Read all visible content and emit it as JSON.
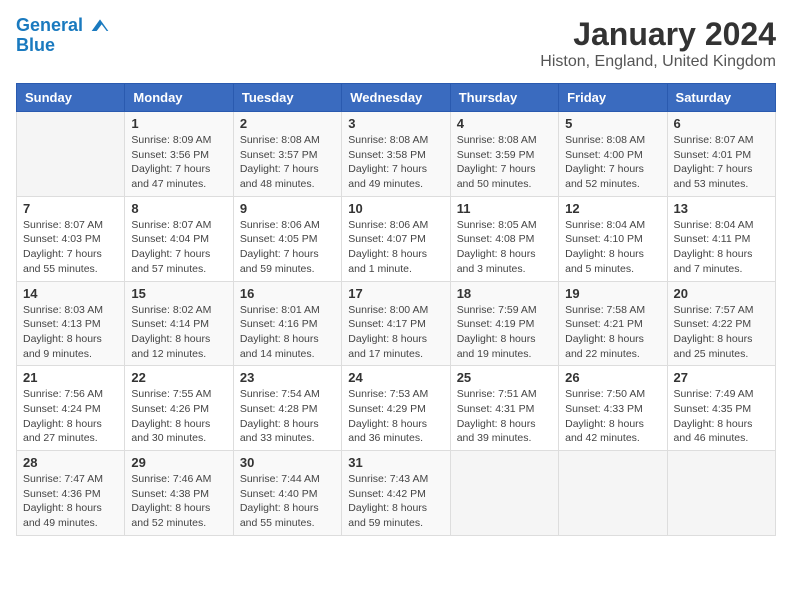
{
  "logo": {
    "line1": "General",
    "line2": "Blue"
  },
  "title": "January 2024",
  "subtitle": "Histon, England, United Kingdom",
  "headers": [
    "Sunday",
    "Monday",
    "Tuesday",
    "Wednesday",
    "Thursday",
    "Friday",
    "Saturday"
  ],
  "weeks": [
    [
      {
        "day": "",
        "info": ""
      },
      {
        "day": "1",
        "info": "Sunrise: 8:09 AM\nSunset: 3:56 PM\nDaylight: 7 hours\nand 47 minutes."
      },
      {
        "day": "2",
        "info": "Sunrise: 8:08 AM\nSunset: 3:57 PM\nDaylight: 7 hours\nand 48 minutes."
      },
      {
        "day": "3",
        "info": "Sunrise: 8:08 AM\nSunset: 3:58 PM\nDaylight: 7 hours\nand 49 minutes."
      },
      {
        "day": "4",
        "info": "Sunrise: 8:08 AM\nSunset: 3:59 PM\nDaylight: 7 hours\nand 50 minutes."
      },
      {
        "day": "5",
        "info": "Sunrise: 8:08 AM\nSunset: 4:00 PM\nDaylight: 7 hours\nand 52 minutes."
      },
      {
        "day": "6",
        "info": "Sunrise: 8:07 AM\nSunset: 4:01 PM\nDaylight: 7 hours\nand 53 minutes."
      }
    ],
    [
      {
        "day": "7",
        "info": "Sunrise: 8:07 AM\nSunset: 4:03 PM\nDaylight: 7 hours\nand 55 minutes."
      },
      {
        "day": "8",
        "info": "Sunrise: 8:07 AM\nSunset: 4:04 PM\nDaylight: 7 hours\nand 57 minutes."
      },
      {
        "day": "9",
        "info": "Sunrise: 8:06 AM\nSunset: 4:05 PM\nDaylight: 7 hours\nand 59 minutes."
      },
      {
        "day": "10",
        "info": "Sunrise: 8:06 AM\nSunset: 4:07 PM\nDaylight: 8 hours\nand 1 minute."
      },
      {
        "day": "11",
        "info": "Sunrise: 8:05 AM\nSunset: 4:08 PM\nDaylight: 8 hours\nand 3 minutes."
      },
      {
        "day": "12",
        "info": "Sunrise: 8:04 AM\nSunset: 4:10 PM\nDaylight: 8 hours\nand 5 minutes."
      },
      {
        "day": "13",
        "info": "Sunrise: 8:04 AM\nSunset: 4:11 PM\nDaylight: 8 hours\nand 7 minutes."
      }
    ],
    [
      {
        "day": "14",
        "info": "Sunrise: 8:03 AM\nSunset: 4:13 PM\nDaylight: 8 hours\nand 9 minutes."
      },
      {
        "day": "15",
        "info": "Sunrise: 8:02 AM\nSunset: 4:14 PM\nDaylight: 8 hours\nand 12 minutes."
      },
      {
        "day": "16",
        "info": "Sunrise: 8:01 AM\nSunset: 4:16 PM\nDaylight: 8 hours\nand 14 minutes."
      },
      {
        "day": "17",
        "info": "Sunrise: 8:00 AM\nSunset: 4:17 PM\nDaylight: 8 hours\nand 17 minutes."
      },
      {
        "day": "18",
        "info": "Sunrise: 7:59 AM\nSunset: 4:19 PM\nDaylight: 8 hours\nand 19 minutes."
      },
      {
        "day": "19",
        "info": "Sunrise: 7:58 AM\nSunset: 4:21 PM\nDaylight: 8 hours\nand 22 minutes."
      },
      {
        "day": "20",
        "info": "Sunrise: 7:57 AM\nSunset: 4:22 PM\nDaylight: 8 hours\nand 25 minutes."
      }
    ],
    [
      {
        "day": "21",
        "info": "Sunrise: 7:56 AM\nSunset: 4:24 PM\nDaylight: 8 hours\nand 27 minutes."
      },
      {
        "day": "22",
        "info": "Sunrise: 7:55 AM\nSunset: 4:26 PM\nDaylight: 8 hours\nand 30 minutes."
      },
      {
        "day": "23",
        "info": "Sunrise: 7:54 AM\nSunset: 4:28 PM\nDaylight: 8 hours\nand 33 minutes."
      },
      {
        "day": "24",
        "info": "Sunrise: 7:53 AM\nSunset: 4:29 PM\nDaylight: 8 hours\nand 36 minutes."
      },
      {
        "day": "25",
        "info": "Sunrise: 7:51 AM\nSunset: 4:31 PM\nDaylight: 8 hours\nand 39 minutes."
      },
      {
        "day": "26",
        "info": "Sunrise: 7:50 AM\nSunset: 4:33 PM\nDaylight: 8 hours\nand 42 minutes."
      },
      {
        "day": "27",
        "info": "Sunrise: 7:49 AM\nSunset: 4:35 PM\nDaylight: 8 hours\nand 46 minutes."
      }
    ],
    [
      {
        "day": "28",
        "info": "Sunrise: 7:47 AM\nSunset: 4:36 PM\nDaylight: 8 hours\nand 49 minutes."
      },
      {
        "day": "29",
        "info": "Sunrise: 7:46 AM\nSunset: 4:38 PM\nDaylight: 8 hours\nand 52 minutes."
      },
      {
        "day": "30",
        "info": "Sunrise: 7:44 AM\nSunset: 4:40 PM\nDaylight: 8 hours\nand 55 minutes."
      },
      {
        "day": "31",
        "info": "Sunrise: 7:43 AM\nSunset: 4:42 PM\nDaylight: 8 hours\nand 59 minutes."
      },
      {
        "day": "",
        "info": ""
      },
      {
        "day": "",
        "info": ""
      },
      {
        "day": "",
        "info": ""
      }
    ]
  ]
}
